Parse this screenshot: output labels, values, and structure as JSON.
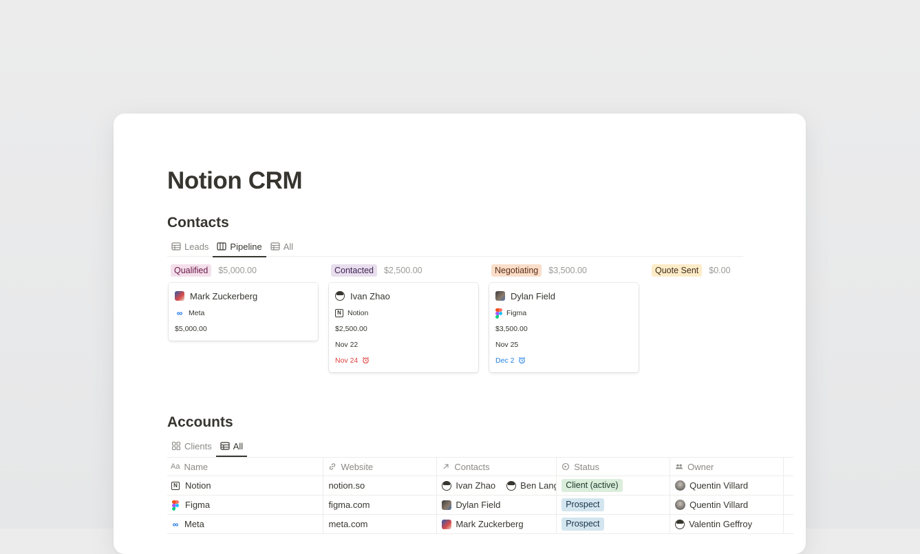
{
  "page": {
    "title": "Notion CRM"
  },
  "contacts": {
    "title": "Contacts",
    "tabs": [
      {
        "label": "Leads",
        "icon": "table-icon",
        "active": false
      },
      {
        "label": "Pipeline",
        "icon": "board-icon",
        "active": true
      },
      {
        "label": "All",
        "icon": "table-icon",
        "active": false
      }
    ],
    "columns": [
      {
        "name": "Qualified",
        "sum": "$5,000.00",
        "color": "#f4dfeb",
        "text_color": "#6c1a4a",
        "card": {
          "name": "Mark Zuckerberg",
          "company": "Meta",
          "amount": "$5,000.00"
        }
      },
      {
        "name": "Contacted",
        "sum": "$2,500.00",
        "color": "#e8deee",
        "text_color": "#412454",
        "card": {
          "name": "Ivan Zhao",
          "company": "Notion",
          "amount": "$2,500.00",
          "date": "Nov 22",
          "reminder": "Nov 24"
        }
      },
      {
        "name": "Negotiating",
        "sum": "$3,500.00",
        "color": "#fadec9",
        "text_color": "#5c2d14",
        "card": {
          "name": "Dylan Field",
          "company": "Figma",
          "amount": "$3,500.00",
          "date": "Nov 25",
          "reminder": "Dec 2"
        }
      },
      {
        "name": "Quote Sent",
        "sum": "$0.00",
        "color": "#fdecc8",
        "text_color": "#402c1b"
      }
    ]
  },
  "accounts": {
    "title": "Accounts",
    "tabs": [
      {
        "label": "Clients",
        "icon": "gallery-icon",
        "active": false
      },
      {
        "label": "All",
        "icon": "table-icon",
        "active": true
      }
    ],
    "headers": {
      "name": "Name",
      "website": "Website",
      "contacts": "Contacts",
      "status": "Status",
      "owner": "Owner"
    },
    "rows": [
      {
        "name": "Notion",
        "website": "notion.so",
        "contacts": [
          "Ivan Zhao",
          "Ben Lang"
        ],
        "status": "Client (active)",
        "status_color": "#dbeddb",
        "status_text": "#1c3829",
        "owner": "Quentin Villard"
      },
      {
        "name": "Figma",
        "website": "figma.com",
        "contacts": [
          "Dylan Field"
        ],
        "status": "Prospect",
        "status_color": "#d3e5ef",
        "status_text": "#183347",
        "owner": "Quentin Villard"
      },
      {
        "name": "Meta",
        "website": "meta.com",
        "contacts": [
          "Mark Zuckerberg"
        ],
        "status": "Prospect",
        "status_color": "#d3e5ef",
        "status_text": "#183347",
        "owner": "Valentin Geffroy"
      }
    ]
  }
}
